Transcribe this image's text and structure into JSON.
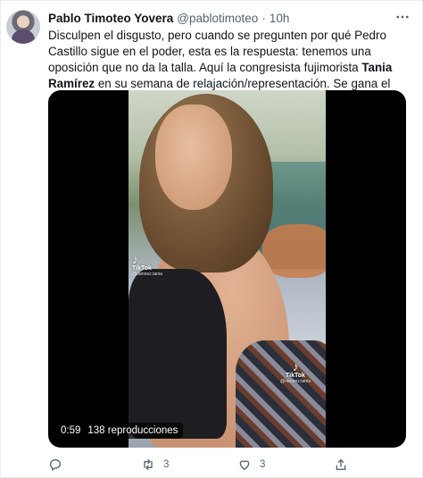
{
  "tweet": {
    "display_name": "Pablo Timoteo Yovera",
    "handle": "@pablotimoteo",
    "separator": "·",
    "time": "10h",
    "text_before_bold": "Disculpen el disgusto, pero cuando se pregunten por qué Pedro Castillo sigue en el poder, esta es la respuesta: tenemos una oposición que no da la talla. Aquí la congresista fujimorista ",
    "text_bold": "Tania Ramírez",
    "text_after_bold": " en su semana de relajación/representación. Se gana el sueldo haciendo tiktoks "
  },
  "media": {
    "duration": "0:59",
    "views": "138 reproducciones",
    "watermark_label": "TikTok",
    "watermark_user": "@ramirez.tania"
  },
  "actions": {
    "retweets": "3",
    "likes": "3"
  },
  "icons": {
    "more": "more-horizontal-icon",
    "reply": "reply-icon",
    "retweet": "retweet-icon",
    "like": "heart-icon",
    "share": "share-icon",
    "emoji": "avocado-icon"
  },
  "colors": {
    "text": "#0f1419",
    "secondary": "#536471",
    "media_bg": "#000000"
  }
}
